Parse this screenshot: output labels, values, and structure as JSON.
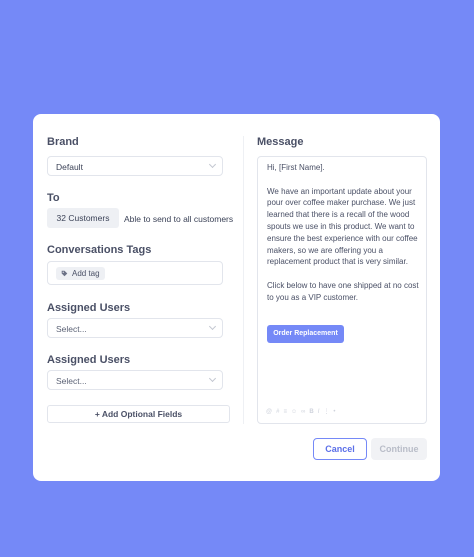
{
  "form": {
    "brand_label": "Brand",
    "brand_value": "Default",
    "to_label": "To",
    "to_chip": "32 Customers",
    "to_note": "Able to send to all customers",
    "tags_label": "Conversations Tags",
    "add_tag": "Add tag",
    "assigned1_label": "Assigned Users",
    "assigned1_placeholder": "Select...",
    "assigned2_label": "Assigned Users",
    "assigned2_placeholder": "Select...",
    "add_fields": "+ Add Optional Fields"
  },
  "message": {
    "label": "Message",
    "greeting": "Hi, [First Name].",
    "para1": "We have an important update about your pour over coffee maker purchase. We just learned that there is a recall of the wood spouts we use in this product. We want to ensure the best experience with our coffee makers, so we are offering you a replacement product that is very similar.",
    "para2": "Click below to have one shipped at no cost to you as a VIP customer.",
    "cta": "Order Replacement",
    "toolbar_icons": [
      "at-icon",
      "hash-icon",
      "list-icon",
      "emoji-icon",
      "link-icon",
      "bold-icon",
      "italic-icon",
      "ordered-list-icon",
      "bullet-list-icon"
    ]
  },
  "actions": {
    "cancel": "Cancel",
    "continue": "Continue"
  },
  "colors": {
    "background": "#7589f7",
    "accent": "#7589f7",
    "disabled": "#f1f2f5"
  }
}
